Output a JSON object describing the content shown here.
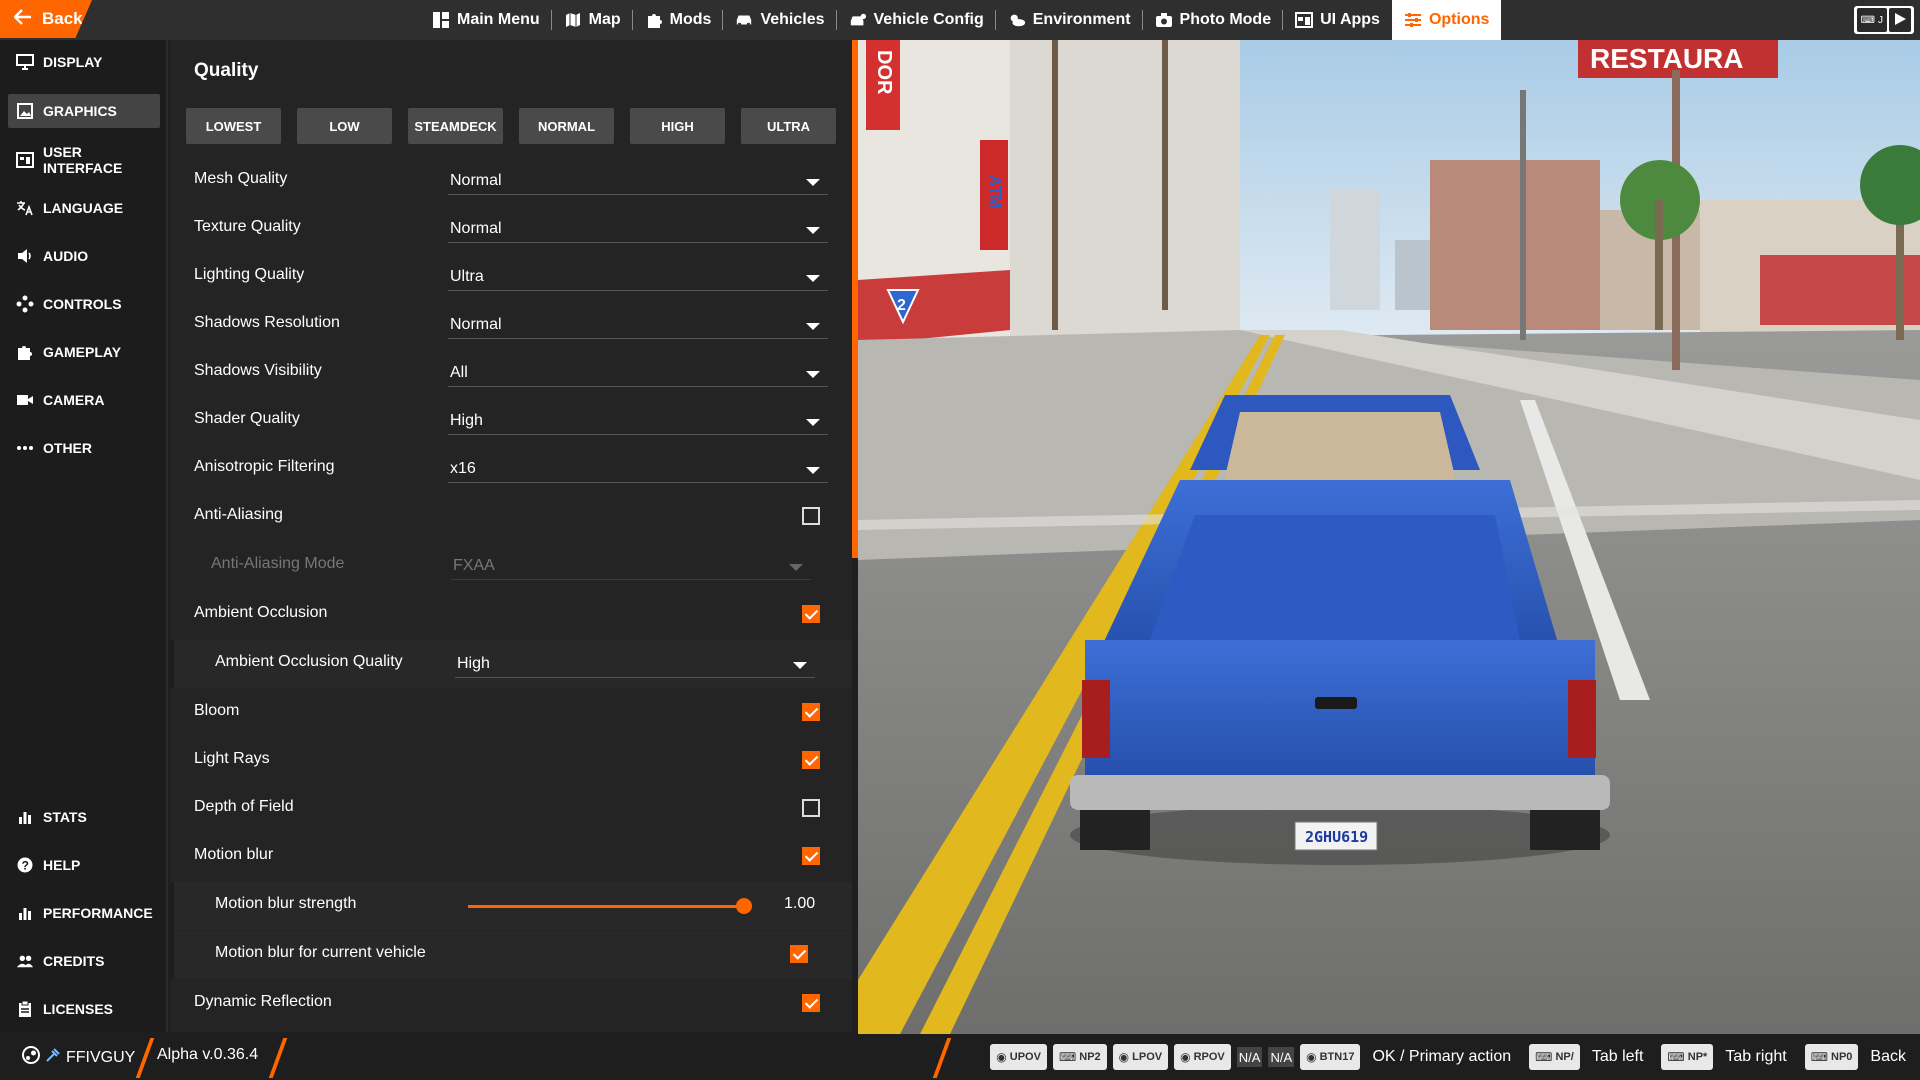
{
  "topbar": {
    "back_label": "Back",
    "nav": [
      {
        "label": "Main Menu",
        "icon": "main-menu-icon"
      },
      {
        "label": "Map",
        "icon": "map-icon"
      },
      {
        "label": "Mods",
        "icon": "mods-icon"
      },
      {
        "label": "Vehicles",
        "icon": "car-icon"
      },
      {
        "label": "Vehicle Config",
        "icon": "vehicle-config-icon"
      },
      {
        "label": "Environment",
        "icon": "weather-icon"
      },
      {
        "label": "Photo Mode",
        "icon": "camera-icon"
      },
      {
        "label": "UI Apps",
        "icon": "ui-apps-icon"
      },
      {
        "label": "Options",
        "icon": "options-icon",
        "active": true
      }
    ],
    "right_keys": [
      "J"
    ]
  },
  "sidebar": {
    "top_items": [
      {
        "label": "DISPLAY",
        "icon": "display-icon"
      },
      {
        "label": "GRAPHICS",
        "icon": "image-icon",
        "active": true
      },
      {
        "label": "USER INTERFACE",
        "icon": "ui-icon"
      },
      {
        "label": "LANGUAGE",
        "icon": "translate-icon"
      },
      {
        "label": "AUDIO",
        "icon": "speaker-icon"
      },
      {
        "label": "CONTROLS",
        "icon": "gamepad-icon"
      },
      {
        "label": "GAMEPLAY",
        "icon": "puzzle-icon"
      },
      {
        "label": "CAMERA",
        "icon": "video-camera-icon"
      },
      {
        "label": "OTHER",
        "icon": "more-icon"
      }
    ],
    "bottom_items": [
      {
        "label": "STATS",
        "icon": "bar-chart-icon"
      },
      {
        "label": "HELP",
        "icon": "help-icon"
      },
      {
        "label": "PERFORMANCE",
        "icon": "bar-chart-icon"
      },
      {
        "label": "CREDITS",
        "icon": "people-icon"
      },
      {
        "label": "LICENSES",
        "icon": "clipboard-icon"
      }
    ]
  },
  "panel": {
    "title": "Quality",
    "presets": [
      "LOWEST",
      "LOW",
      "STEAMDECK",
      "NORMAL",
      "HIGH",
      "ULTRA"
    ],
    "rows": [
      {
        "label": "Mesh Quality",
        "type": "dropdown",
        "value": "Normal"
      },
      {
        "label": "Texture Quality",
        "type": "dropdown",
        "value": "Normal"
      },
      {
        "label": "Lighting Quality",
        "type": "dropdown",
        "value": "Ultra"
      },
      {
        "label": "Shadows Resolution",
        "type": "dropdown",
        "value": "Normal"
      },
      {
        "label": "Shadows Visibility",
        "type": "dropdown",
        "value": "All"
      },
      {
        "label": "Shader Quality",
        "type": "dropdown",
        "value": "High"
      },
      {
        "label": "Anisotropic Filtering",
        "type": "dropdown",
        "value": "x16"
      },
      {
        "label": "Anti-Aliasing",
        "type": "checkbox",
        "checked": false
      },
      {
        "label": "Anti-Aliasing Mode",
        "type": "dropdown",
        "value": "FXAA",
        "sub": true,
        "disabled": true
      },
      {
        "label": "Ambient Occlusion",
        "type": "checkbox",
        "checked": true
      },
      {
        "label": "Ambient Occlusion Quality",
        "type": "dropdown",
        "value": "High",
        "sub": true,
        "box": true
      },
      {
        "label": "Bloom",
        "type": "checkbox",
        "checked": true
      },
      {
        "label": "Light Rays",
        "type": "checkbox",
        "checked": true
      },
      {
        "label": "Depth of Field",
        "type": "checkbox",
        "checked": false
      },
      {
        "label": "Motion blur",
        "type": "checkbox",
        "checked": true
      },
      {
        "label": "Motion blur strength",
        "type": "slider",
        "value": "1.00",
        "fraction": 1.0,
        "sub": true,
        "box": true
      },
      {
        "label": "Motion blur for current vehicle",
        "type": "checkbox",
        "checked": true,
        "sub": true,
        "box": true
      },
      {
        "label": "Dynamic Reflection",
        "type": "checkbox",
        "checked": true
      }
    ]
  },
  "bottombar": {
    "username": "FFIVGUY",
    "version": "Alpha v.0.36.4",
    "hints": [
      {
        "keys": [
          "UPOV",
          "NP2",
          "LPOV",
          "RPOV",
          "N/A",
          "N/A",
          "BTN17"
        ],
        "text": "OK / Primary action"
      },
      {
        "keys": [
          "NP/"
        ],
        "text": "Tab left"
      },
      {
        "keys": [
          "NP*"
        ],
        "text": "Tab right"
      },
      {
        "keys": [
          "NP0"
        ],
        "text": "Back"
      }
    ]
  },
  "scene": {
    "plate": "2GHU619",
    "sign_restaurant": "RESTAURA",
    "sign_atm": "ATM",
    "sign_dor": "DOR",
    "route_marker": "2",
    "colors": {
      "accent": "#ff6600",
      "truck": "#2f5fc9",
      "sky": "#bcd6ea"
    }
  }
}
